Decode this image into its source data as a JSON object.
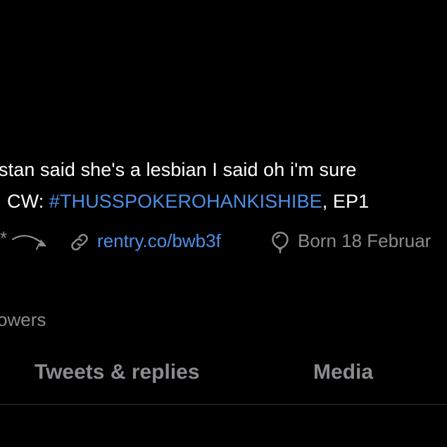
{
  "profile": {
    "bio_line1": "stan said she's a lesbian I said oh i'm sure",
    "bio_line2_prefix": "CW: ",
    "bio_hashtag": "#THUSSPOKEROHANKISHIBE",
    "bio_line2_suffix": ", EP1",
    "meta_prefix": "*",
    "website": "rentry.co/bwb3f",
    "birthday": "Born 18 Februar",
    "followers_label": "owers"
  },
  "tabs": [
    {
      "label": "Tweets & replies"
    },
    {
      "label": "Media"
    }
  ],
  "icons": {
    "link": "link-icon",
    "birthday": "balloon-icon",
    "decoration": "arrow-decoration-icon"
  },
  "colors": {
    "background": "#000000",
    "text": "#ffffff",
    "secondary": "#8b8b8f",
    "accent": "#4d8fe6"
  }
}
